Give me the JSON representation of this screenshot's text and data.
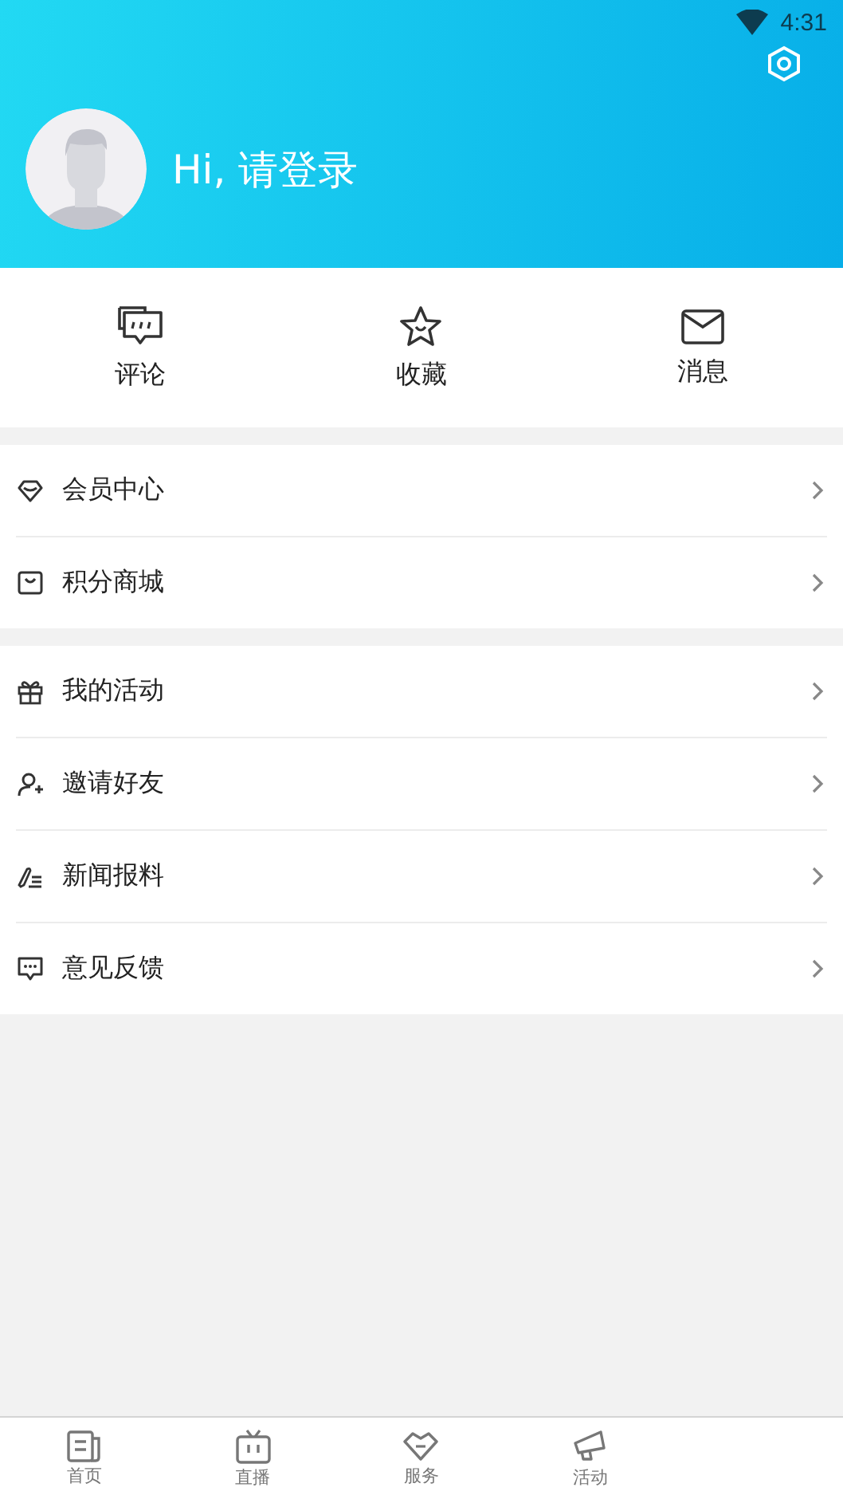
{
  "status_bar": {
    "time": "4:31"
  },
  "header": {
    "greeting": "Hi, 请登录"
  },
  "quick_actions": [
    {
      "label": "评论"
    },
    {
      "label": "收藏"
    },
    {
      "label": "消息"
    }
  ],
  "menu_groups": [
    [
      {
        "label": "会员中心"
      },
      {
        "label": "积分商城"
      }
    ],
    [
      {
        "label": "我的活动"
      },
      {
        "label": "邀请好友"
      },
      {
        "label": "新闻报料"
      },
      {
        "label": "意见反馈"
      }
    ]
  ],
  "tab_bar": [
    {
      "label": "首页",
      "selected": false
    },
    {
      "label": "直播",
      "selected": false
    },
    {
      "label": "服务",
      "selected": false
    },
    {
      "label": "活动",
      "selected": false
    }
  ]
}
